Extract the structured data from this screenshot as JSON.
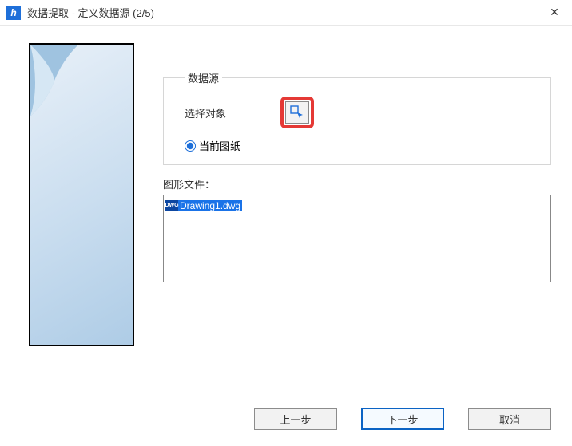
{
  "titlebar": {
    "icon_text": "h",
    "title": "数据提取 - 定义数据源 (2/5)",
    "close_glyph": "✕"
  },
  "data_source": {
    "legend": "数据源",
    "select_objects_label": "选择对象",
    "current_drawing_label": "当前图纸"
  },
  "files": {
    "label": "图形文件：",
    "items": [
      {
        "icon": "DWG",
        "name": "Drawing1.dwg"
      }
    ]
  },
  "footer": {
    "prev": "上一步",
    "next": "下一步",
    "cancel": "取消"
  }
}
